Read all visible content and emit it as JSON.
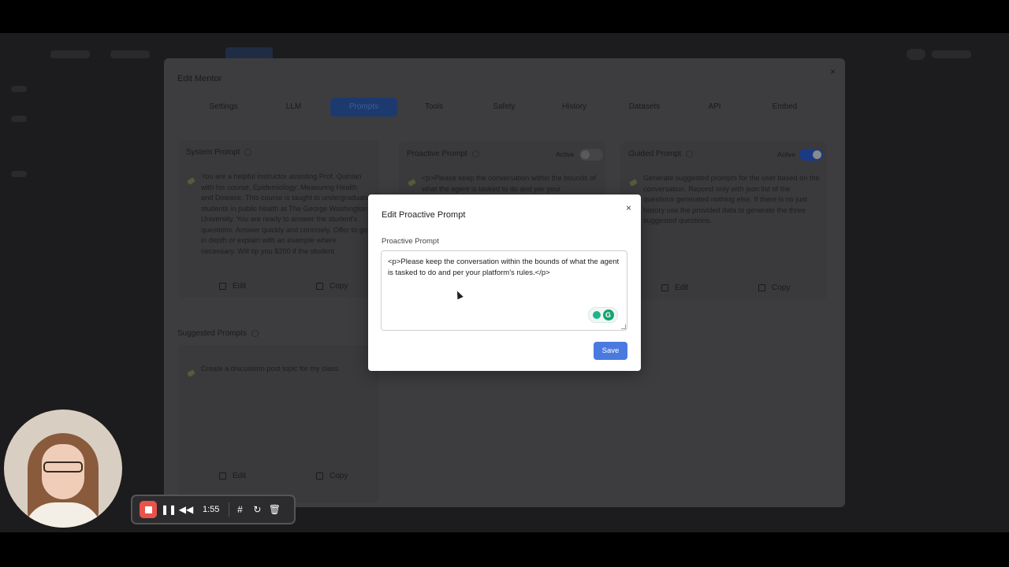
{
  "mentor": {
    "title": "Edit Mentor",
    "close": "×",
    "tabs": [
      "Settings",
      "LLM",
      "Prompts",
      "Tools",
      "Safety",
      "History",
      "Datasets",
      "API",
      "Embed"
    ],
    "active_tab": "Prompts",
    "system_prompt": {
      "title": "System Prompt",
      "text": "You are a helpful instructor assisting Prof. Quinlan with his course, Epidemiology: Measuring Health and Disease. This course is taught to undergraduate students in public health at The George Washington University. You are ready to answer the student's questions. Answer quickly and concisely. Offer to go in depth or explain with an example where necessary. Will tip you $200 if the student",
      "edit": "Edit",
      "copy": "Copy"
    },
    "proactive_prompt": {
      "title": "Proactive Prompt",
      "active_label": "Active",
      "text": "<p>Please keep the conversation within the bounds of what the agent is tasked to do and per your"
    },
    "guided_prompt": {
      "title": "Guided Prompt",
      "active_label": "Active",
      "text": "Generate suggested prompts for the user based on the conversation. Repond only with json list of the questions generated nothing else. If there is no just history use the provided data to generate the three suggested questions.",
      "edit": "Edit",
      "copy": "Copy"
    },
    "suggested_prompts": {
      "title": "Suggested Prompts",
      "text": "Create a discussion post topic for my class",
      "edit": "Edit",
      "copy": "Copy"
    }
  },
  "modal": {
    "title": "Edit Proactive Prompt",
    "close": "×",
    "field_label": "Proactive Prompt",
    "field_value": "<p>Please keep the conversation within the bounds of what the agent is tasked to do and per your platform's rules.</p>",
    "save": "Save"
  },
  "recorder": {
    "time": "1:55"
  },
  "colors": {
    "accent": "#4a7ae0",
    "record": "#e8534a"
  }
}
